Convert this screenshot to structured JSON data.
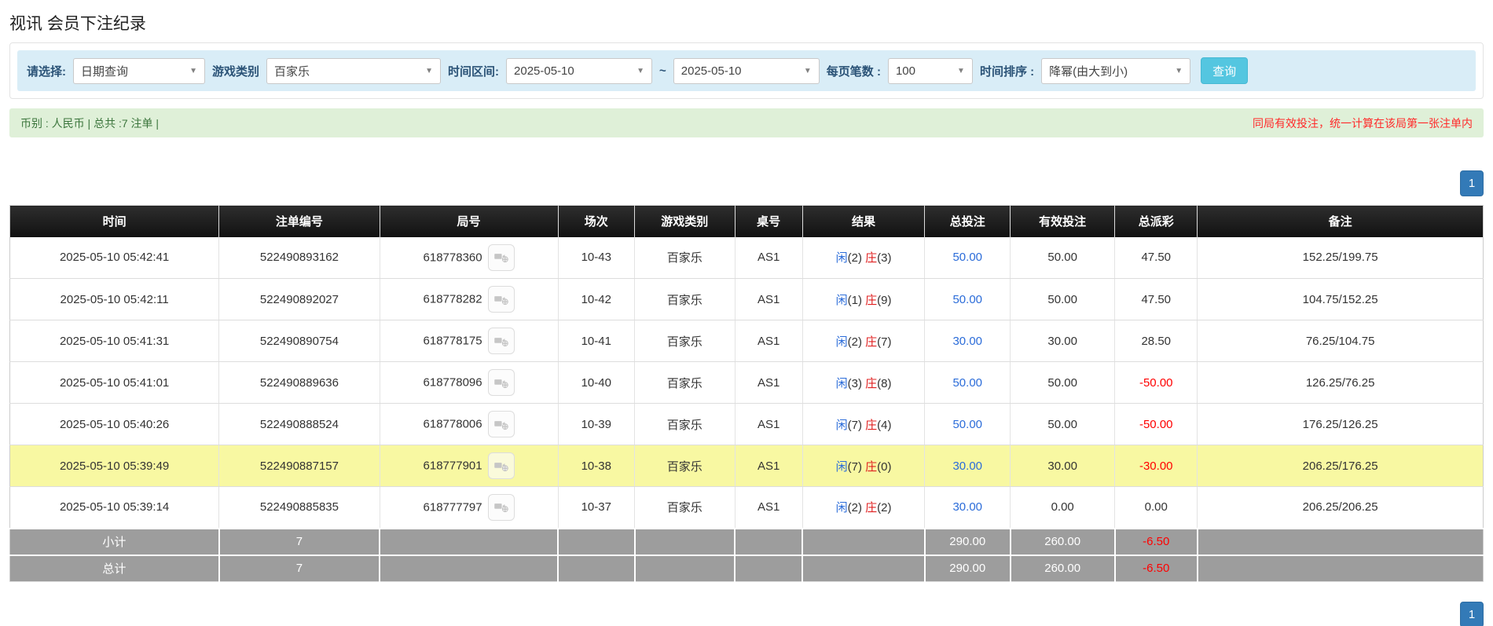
{
  "page": {
    "title": "视讯 会员下注纪录"
  },
  "filters": {
    "select_label": "请选择:",
    "select_value": "日期查询",
    "game_type_label": "游戏类别",
    "game_type_value": "百家乐",
    "date_range_label": "时间区间:",
    "date_from": "2025-05-10",
    "date_separator": "~",
    "date_to": "2025-05-10",
    "page_size_label": "每页笔数 :",
    "page_size_value": "100",
    "sort_label": "时间排序 :",
    "sort_value": "降幂(由大到小)",
    "search_button": "查询"
  },
  "summary": {
    "left_text": "币别 : 人民币 | 总共 :7 注单 |",
    "right_note": "同局有效投注，统一计算在该局第一张注单内"
  },
  "pagination": {
    "page": "1"
  },
  "table": {
    "headers": [
      "时间",
      "注单编号",
      "局号",
      "场次",
      "游戏类别",
      "桌号",
      "结果",
      "总投注",
      "有效投注",
      "总派彩",
      "备注"
    ],
    "rows": [
      {
        "time": "2025-05-10 05:42:41",
        "bet_id": "522490893162",
        "round_id": "618778360",
        "session": "10-43",
        "game": "百家乐",
        "table_no": "AS1",
        "player": "闲",
        "player_score": "(2)",
        "banker": "庄",
        "banker_score": "(3)",
        "total_bet": "50.00",
        "valid_bet": "50.00",
        "payout": "47.50",
        "remark": "152.25/199.75",
        "highlight": false
      },
      {
        "time": "2025-05-10 05:42:11",
        "bet_id": "522490892027",
        "round_id": "618778282",
        "session": "10-42",
        "game": "百家乐",
        "table_no": "AS1",
        "player": "闲",
        "player_score": "(1)",
        "banker": "庄",
        "banker_score": "(9)",
        "total_bet": "50.00",
        "valid_bet": "50.00",
        "payout": "47.50",
        "remark": "104.75/152.25",
        "highlight": false
      },
      {
        "time": "2025-05-10 05:41:31",
        "bet_id": "522490890754",
        "round_id": "618778175",
        "session": "10-41",
        "game": "百家乐",
        "table_no": "AS1",
        "player": "闲",
        "player_score": "(2)",
        "banker": "庄",
        "banker_score": "(7)",
        "total_bet": "30.00",
        "valid_bet": "30.00",
        "payout": "28.50",
        "remark": "76.25/104.75",
        "highlight": false
      },
      {
        "time": "2025-05-10 05:41:01",
        "bet_id": "522490889636",
        "round_id": "618778096",
        "session": "10-40",
        "game": "百家乐",
        "table_no": "AS1",
        "player": "闲",
        "player_score": "(3)",
        "banker": "庄",
        "banker_score": "(8)",
        "total_bet": "50.00",
        "valid_bet": "50.00",
        "payout": "-50.00",
        "remark": "126.25/76.25",
        "highlight": false
      },
      {
        "time": "2025-05-10 05:40:26",
        "bet_id": "522490888524",
        "round_id": "618778006",
        "session": "10-39",
        "game": "百家乐",
        "table_no": "AS1",
        "player": "闲",
        "player_score": "(7)",
        "banker": "庄",
        "banker_score": "(4)",
        "total_bet": "50.00",
        "valid_bet": "50.00",
        "payout": "-50.00",
        "remark": "176.25/126.25",
        "highlight": false
      },
      {
        "time": "2025-05-10 05:39:49",
        "bet_id": "522490887157",
        "round_id": "618777901",
        "session": "10-38",
        "game": "百家乐",
        "table_no": "AS1",
        "player": "闲",
        "player_score": "(7)",
        "banker": "庄",
        "banker_score": "(0)",
        "total_bet": "30.00",
        "valid_bet": "30.00",
        "payout": "-30.00",
        "remark": "206.25/176.25",
        "highlight": true
      },
      {
        "time": "2025-05-10 05:39:14",
        "bet_id": "522490885835",
        "round_id": "618777797",
        "session": "10-37",
        "game": "百家乐",
        "table_no": "AS1",
        "player": "闲",
        "player_score": "(2)",
        "banker": "庄",
        "banker_score": "(2)",
        "total_bet": "30.00",
        "valid_bet": "0.00",
        "payout": "0.00",
        "remark": "206.25/206.25",
        "highlight": false
      }
    ],
    "subtotal": {
      "label": "小计",
      "count": "7",
      "total_bet": "290.00",
      "valid_bet": "260.00",
      "payout": "-6.50"
    },
    "total": {
      "label": "总计",
      "count": "7",
      "total_bet": "290.00",
      "valid_bet": "260.00",
      "payout": "-6.50"
    }
  },
  "colors": {
    "accent_blue": "#337ab7",
    "link_blue": "#2b6cd9",
    "player_blue": "#2b6cd9",
    "banker_red": "#e02020",
    "negative_red": "#ff0000",
    "filter_bar_bg": "#d9edf7",
    "summary_bg": "#dff0d8",
    "summary_text": "#3c763d",
    "note_red": "#ff2a2a",
    "highlight_yellow": "#f8f8a2",
    "total_row_bg": "#9d9d9d",
    "search_btn_bg": "#54c6e0"
  }
}
